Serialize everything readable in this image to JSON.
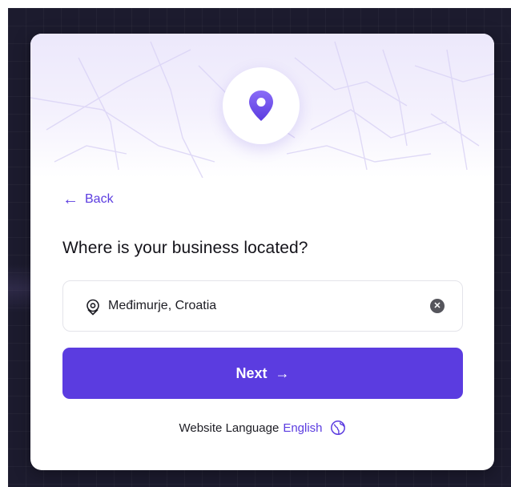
{
  "back": {
    "label": "Back"
  },
  "question": "Where is your business located?",
  "location_input": {
    "value": "Međimurje, Croatia"
  },
  "next_button": {
    "label": "Next",
    "arrow": "→"
  },
  "language": {
    "prefix": "Website Language",
    "current": "English"
  },
  "icons": {
    "hero": "location-pin-icon",
    "back": "arrow-left-icon",
    "input": "location-pin-outline-icon",
    "clear": "clear-circle-icon",
    "next": "arrow-right-icon",
    "language": "globe-icon"
  },
  "colors": {
    "accent": "#5b3ce0",
    "backdrop": "#1c1b2e",
    "card": "#ffffff"
  }
}
